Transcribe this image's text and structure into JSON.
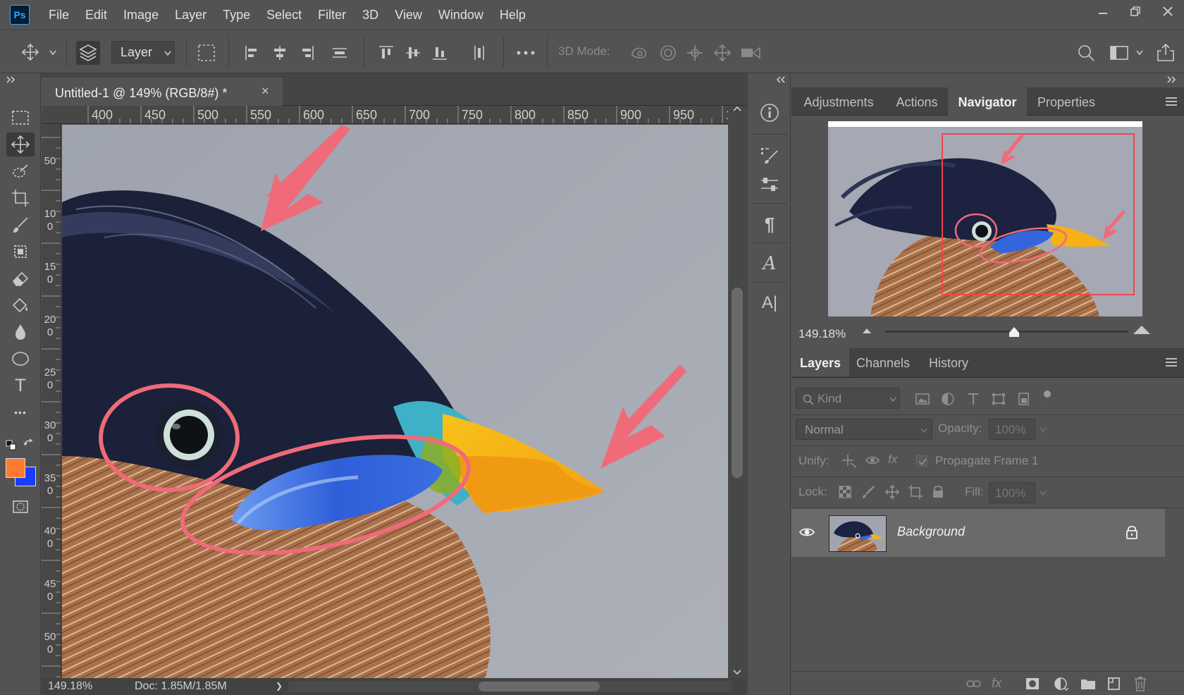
{
  "app": {
    "logo": "Ps",
    "menu": [
      "File",
      "Edit",
      "Image",
      "Layer",
      "Type",
      "Select",
      "Filter",
      "3D",
      "View",
      "Window",
      "Help"
    ]
  },
  "options_bar": {
    "layer_select": "Layer",
    "mode3d_label": "3D Mode:"
  },
  "document": {
    "tab_title": "Untitled-1 @ 149% (RGB/8#) *",
    "close_glyph": "×",
    "ruler_top": [
      "400",
      "450",
      "500",
      "550",
      "600",
      "650",
      "700",
      "750",
      "800",
      "850",
      "900",
      "950",
      "1"
    ],
    "ruler_left": [
      "50",
      "100",
      "150",
      "200",
      "250",
      "300",
      "350",
      "400",
      "450",
      "500"
    ],
    "status_zoom": "149.18%",
    "status_doc": "Doc: 1.85M/1.85M",
    "status_arrow": "❯"
  },
  "colors": {
    "foreground": "#ff7a2f",
    "background": "#1a3cff",
    "annotation": "#ef6b7a"
  },
  "panels": {
    "top_tabs": [
      "Adjustments",
      "Actions",
      "Navigator",
      "Properties"
    ],
    "active_top_tab": "Navigator",
    "navigator_zoom": "149.18%",
    "layer_tabs": [
      "Layers",
      "Channels",
      "History"
    ],
    "active_layer_tab": "Layers",
    "kind_placeholder": "Kind",
    "blend_mode": "Normal",
    "opacity_label": "Opacity:",
    "opacity_value": "100%",
    "unify_label": "Unify:",
    "propagate_label": "Propagate Frame 1",
    "lock_label": "Lock:",
    "fill_label": "Fill:",
    "fill_value": "100%",
    "layer_name": "Background",
    "footer_fx": "fx"
  },
  "mid_panel_icons": [
    "info-icon",
    "brush-settings-icon",
    "tool-presets-icon",
    "paragraph-icon",
    "character-icon",
    "glyphs-icon"
  ],
  "mid_panel_glyphs": {
    "paragraph": "¶",
    "character": "A",
    "glyphs": "A|"
  },
  "toolbar_glyphs": {
    "type": "T",
    "more": "•••"
  }
}
